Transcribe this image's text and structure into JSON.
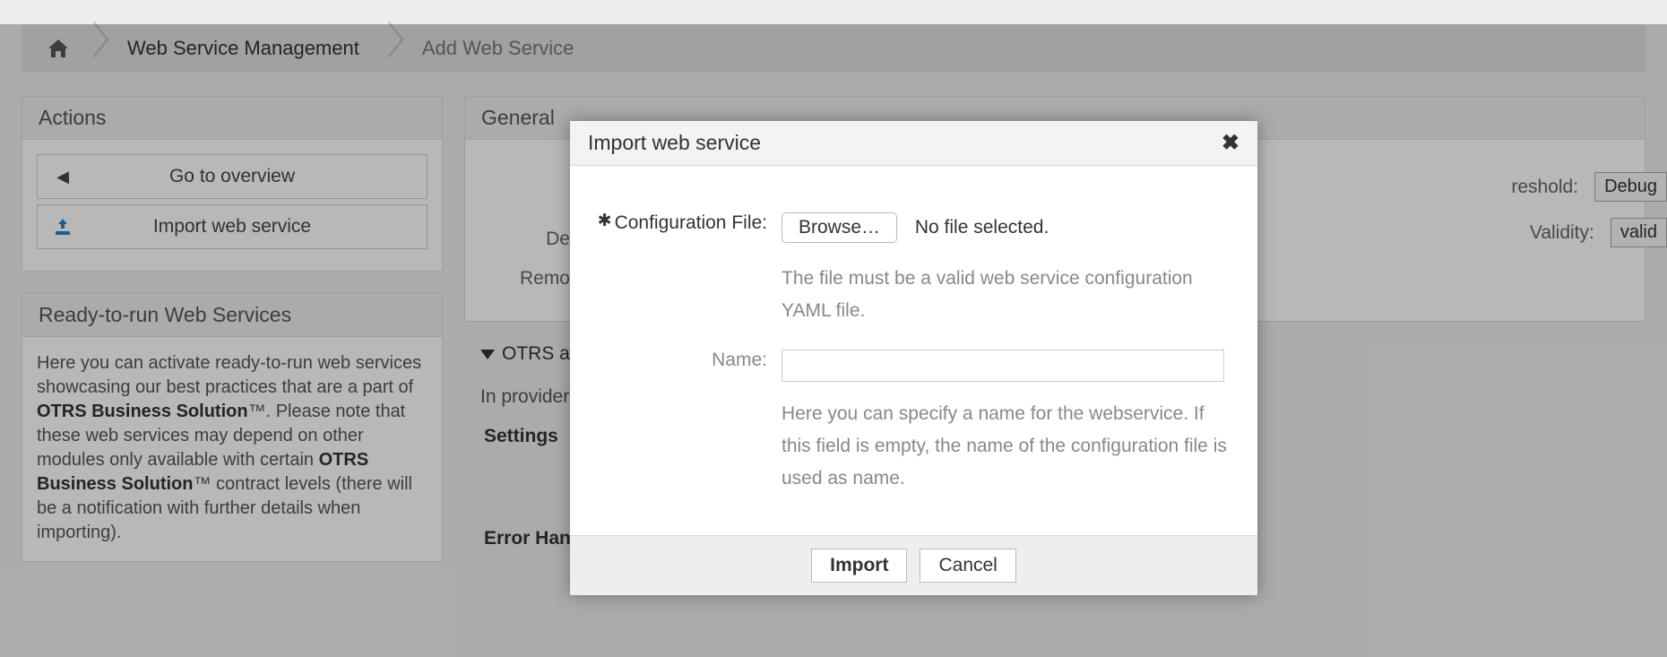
{
  "breadcrumb": {
    "home": "home",
    "items": [
      "Web Service Management",
      "Add Web Service"
    ]
  },
  "actions": {
    "title": "Actions",
    "overview_label": "Go to overview",
    "import_label": "Import web service"
  },
  "ready": {
    "title": "Ready-to-run Web Services",
    "text_1": "Here you can activate ready-to-run web services showcasing our best practices that are a part of ",
    "bold_1": "OTRS Business Solution",
    "tm": "™",
    "text_2": ". Please note that these web services may depend on other modules only available with certain ",
    "bold_2": "OTRS Business Solution",
    "text_3": " contract levels (there will be a notification with further details when importing)."
  },
  "general": {
    "title": "General",
    "desc_label": "De",
    "remote_label": "Remo",
    "threshold_label": "reshold:",
    "threshold_value": "Debug",
    "validity_label": "Validity:",
    "validity_value": "valid"
  },
  "provider": {
    "title": "OTRS as p",
    "intro": "In provider mo",
    "settings_h": "Settings",
    "err_h": "Error Handling"
  },
  "modal": {
    "title": "Import web service",
    "conf_label": "Configuration File:",
    "browse_label": "Browse…",
    "file_status": "No file selected.",
    "conf_hint": "The file must be a valid web service configuration YAML file.",
    "name_label": "Name:",
    "name_hint": "Here you can specify a name for the webservice. If this field is empty, the name of the configuration file is used as name.",
    "import_btn": "Import",
    "cancel_btn": "Cancel"
  }
}
